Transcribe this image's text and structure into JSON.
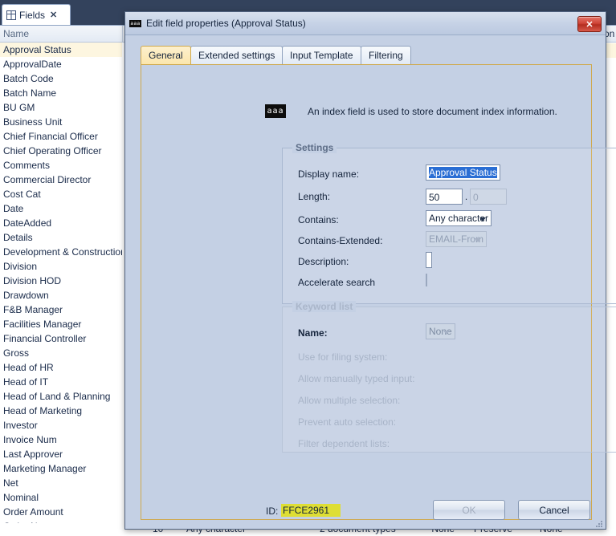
{
  "background": {
    "tab": {
      "label": "Fields",
      "icon": "grid-icon",
      "close": "✕"
    },
    "grid": {
      "column_name": "Name",
      "column_right_partial": "on",
      "fields": [
        "Approval Status",
        "ApprovalDate",
        "Batch Code",
        "Batch Name",
        "BU GM",
        "Business Unit",
        "Chief Financial Officer",
        "Chief Operating Officer",
        "Comments",
        "Commercial Director",
        "Cost Cat",
        "Date",
        "DateAdded",
        "Details",
        "Development & Construction Di",
        "Division",
        "Division HOD",
        "Drawdown",
        "F&B Manager",
        "Facilities Manager",
        "Financial Controller",
        "Gross",
        "Head of HR",
        "Head of IT",
        "Head of Land & Planning",
        "Head of Marketing",
        "Investor",
        "Invoice Num",
        "Last Approver",
        "Marketing Manager",
        "Net",
        "Nominal",
        "Order Amount",
        "Order Num"
      ],
      "selected_field": "Approval Status",
      "bottom_row": [
        "10",
        "Any character",
        "2 document types",
        "*** None ***",
        "Preserve",
        "None"
      ]
    }
  },
  "dialog": {
    "title": "Edit field properties (Approval Status)",
    "title_icon": "aaa",
    "close_label": "✕",
    "tabs": [
      {
        "label": "General",
        "active": true
      },
      {
        "label": "Extended settings",
        "active": false
      },
      {
        "label": "Input Template",
        "active": false
      },
      {
        "label": "Filtering",
        "active": false
      }
    ],
    "info": {
      "icon_text": "aaa",
      "text": "An index field is used to store document index information."
    },
    "settings": {
      "legend": "Settings",
      "display_name_label": "Display name:",
      "display_name_value": "Approval Status",
      "length_label": "Length:",
      "length_value": "50",
      "length_separator": ".",
      "decimals_value": "0",
      "contains_label": "Contains:",
      "contains_value": "Any character",
      "contains_extended_label": "Contains-Extended:",
      "contains_extended_value": "EMAIL-From",
      "description_label": "Description:",
      "description_value": "",
      "accelerate_search_label": "Accelerate search",
      "accelerate_search_checked": false
    },
    "keyword_list": {
      "legend": "Keyword list",
      "name_label": "Name:",
      "name_value": "None",
      "rows": [
        {
          "label": "Use for filing system:",
          "checked": false
        },
        {
          "label": "Allow manually typed input:",
          "checked": true
        },
        {
          "label": "Allow multiple selection:",
          "checked": false
        },
        {
          "label": "Prevent auto selection:",
          "checked": false
        },
        {
          "label": "Filter dependent lists:",
          "checked": false
        }
      ]
    },
    "footer": {
      "id_label": "ID:",
      "id_value": "FFCE2961",
      "ok_label": "OK",
      "cancel_label": "Cancel"
    }
  },
  "colors": {
    "dialog_bg": "#c4d0e4",
    "accent_tab": "#fbe6ad",
    "highlight_yellow": "#dede34",
    "selection_blue": "#2a6ed4",
    "topbar": "#33425c"
  }
}
